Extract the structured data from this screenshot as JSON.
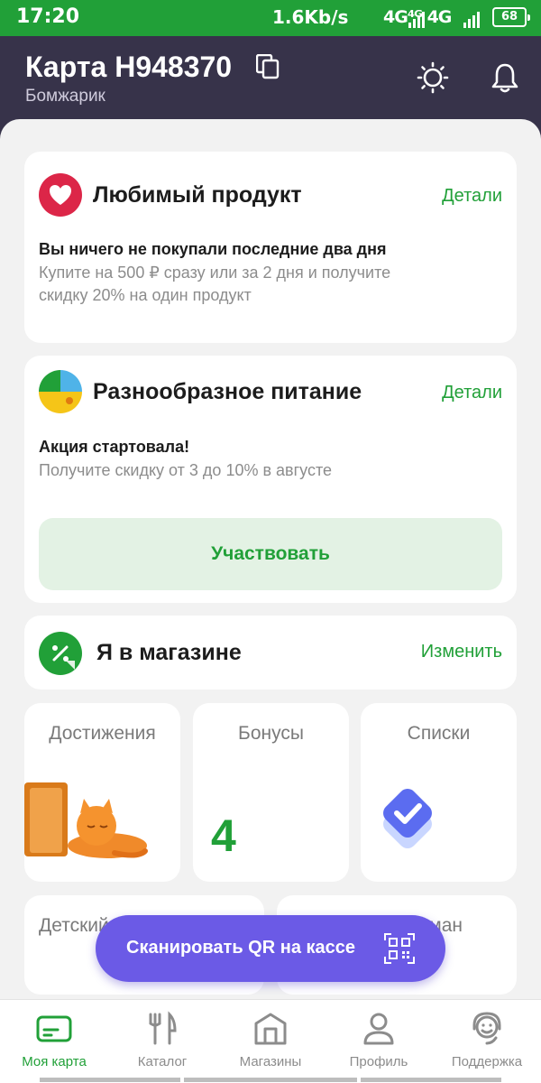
{
  "status_bar": {
    "time": "17:20",
    "speed": "1.6Kb/s",
    "network": "4G⁴ᴳ 4G",
    "battery": "68"
  },
  "header": {
    "title": "Карта Н948370",
    "subtitle": "Бомжарик"
  },
  "cards": {
    "favorite": {
      "title": "Любимый продукт",
      "link": "Детали",
      "main": "Вы ничего не покупали последние два дня",
      "sub_line1": "Купите на 500 ₽ сразу или за 2 дня и получите",
      "sub_line2": "скидку 20% на один продукт"
    },
    "diverse": {
      "title": "Разнообразное питание",
      "link": "Детали",
      "main": "Акция стартовала!",
      "sub": "Получите скидку от 3 до 10% в августе",
      "button": "Участвовать"
    },
    "store": {
      "title": "Я в магазине",
      "link": "Изменить"
    }
  },
  "tiles": {
    "achievements": {
      "title": "Достижения"
    },
    "bonuses": {
      "title": "Бонусы",
      "value": "4"
    },
    "lists": {
      "title": "Списки"
    },
    "kids": {
      "title": "Детский"
    },
    "partial": {
      "title": "ман"
    }
  },
  "scan_button": {
    "label": "Сканировать QR на кассе"
  },
  "nav": {
    "items": [
      {
        "label": "Моя карта",
        "icon": "card-icon"
      },
      {
        "label": "Каталог",
        "icon": "cutlery-icon"
      },
      {
        "label": "Магазины",
        "icon": "store-icon"
      },
      {
        "label": "Профиль",
        "icon": "profile-icon"
      },
      {
        "label": "Поддержка",
        "icon": "support-icon"
      }
    ]
  },
  "colors": {
    "brand": "#21a038",
    "header": "#37334a",
    "scan": "#6b5ae6",
    "heart": "#dc2648"
  }
}
